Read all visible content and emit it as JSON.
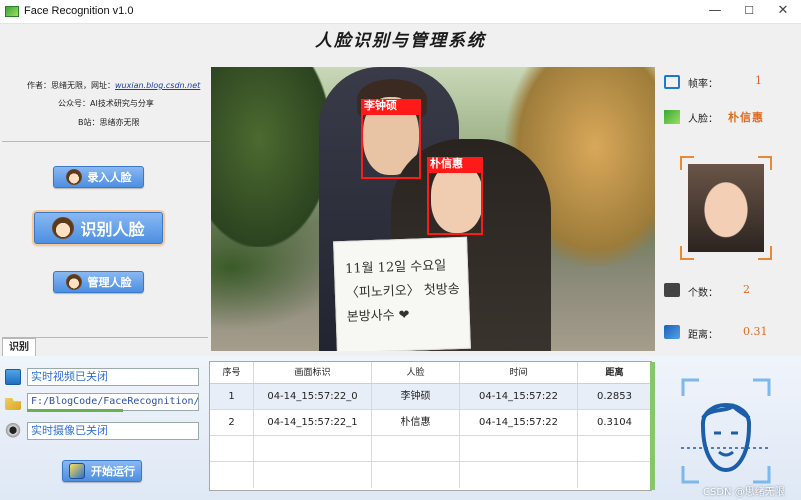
{
  "window": {
    "title": "Face Recognition v1.0",
    "minimize": "—",
    "maximize": "☐",
    "close": "✕"
  },
  "app_title": "人脸识别与管理系统",
  "info": {
    "author_prefix": "作者：思绪无限，网址：",
    "author_link": "wuxian.blog.csdn.net",
    "wechat": "公众号：AI技术研究与分享",
    "bilibili": "B站：思绪亦无限"
  },
  "buttons": {
    "enroll": "录入人脸",
    "recognize": "识别人脸",
    "manage": "管理人脸",
    "start": "开始运行"
  },
  "tab": {
    "label": "识别"
  },
  "status": {
    "video": "实时视频已关闭",
    "path": "F:/BlogCode/FaceRecognition/",
    "camera": "实时摄像已关闭"
  },
  "photo": {
    "sign_text_1": "11월 12일 수요일",
    "sign_text_2": "〈피노키오〉 첫방송",
    "sign_text_3": "본방사수 ❤",
    "faces": [
      {
        "label": "李钟硕"
      },
      {
        "label": "朴信惠"
      }
    ]
  },
  "right": {
    "fps_label": "帧率：",
    "fps_value": "1",
    "face_label": "人脸：",
    "face_value": "朴信惠",
    "count_label": "个数：",
    "count_value": "2",
    "distance_label": "距离：",
    "distance_value": "0.31"
  },
  "table": {
    "headers": [
      "序号",
      "画面标识",
      "人脸",
      "时间",
      "距离"
    ],
    "rows": [
      [
        "1",
        "04-14_15:57:22_0",
        "李钟硕",
        "04-14_15:57:22",
        "0.2853"
      ],
      [
        "2",
        "04-14_15:57:22_1",
        "朴信惠",
        "04-14_15:57:22",
        "0.3104"
      ]
    ]
  },
  "watermark": "CSDN @思绪无限",
  "colors": {
    "accent_blue": "#4c8fe2",
    "value_orange": "#e06a20",
    "bbox_red": "#ff1a1a",
    "status_blue": "#2f6fd6"
  }
}
